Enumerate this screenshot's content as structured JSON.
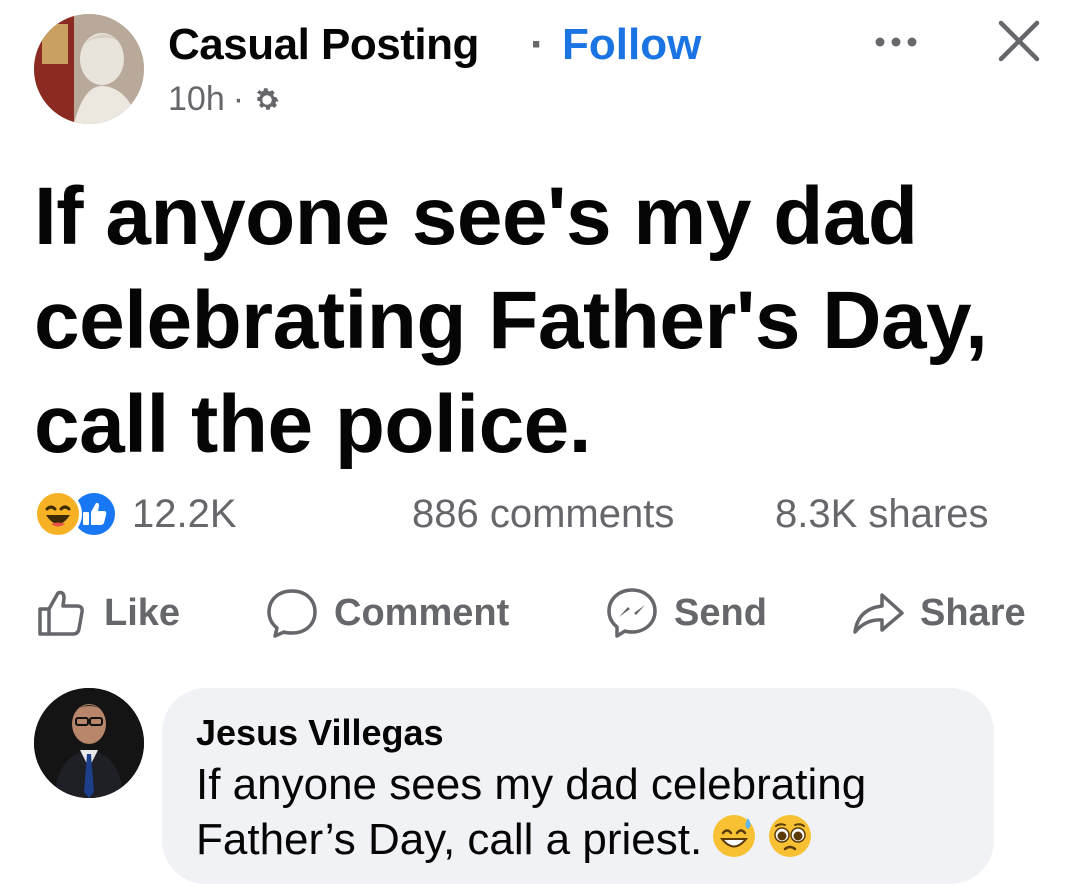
{
  "post": {
    "page_name": "Casual Posting",
    "separator": "·",
    "follow_label": "Follow",
    "time": "10h",
    "time_separator": "·",
    "text": "If anyone see's my dad celebrating Father's Day, call the police.",
    "reactions_count": "12.2K",
    "comments_count": "886 comments",
    "shares_count": "8.3K shares",
    "reaction_icons": [
      "haha-icon",
      "like-icon"
    ]
  },
  "actions": {
    "like": "Like",
    "comment": "Comment",
    "send": "Send",
    "share": "Share"
  },
  "comment": {
    "author": "Jesus Villegas",
    "text": "If anyone sees my dad celebrating Father’s Day, call a priest.",
    "emojis": [
      "sweat-smile-emoji",
      "pleading-face-emoji"
    ]
  },
  "colors": {
    "follow": "#1b74e4",
    "secondary_text": "#65676b",
    "comment_bubble": "#f0f2f5",
    "like_blue": "#1877f2",
    "haha_yellow": "#f7b125"
  }
}
